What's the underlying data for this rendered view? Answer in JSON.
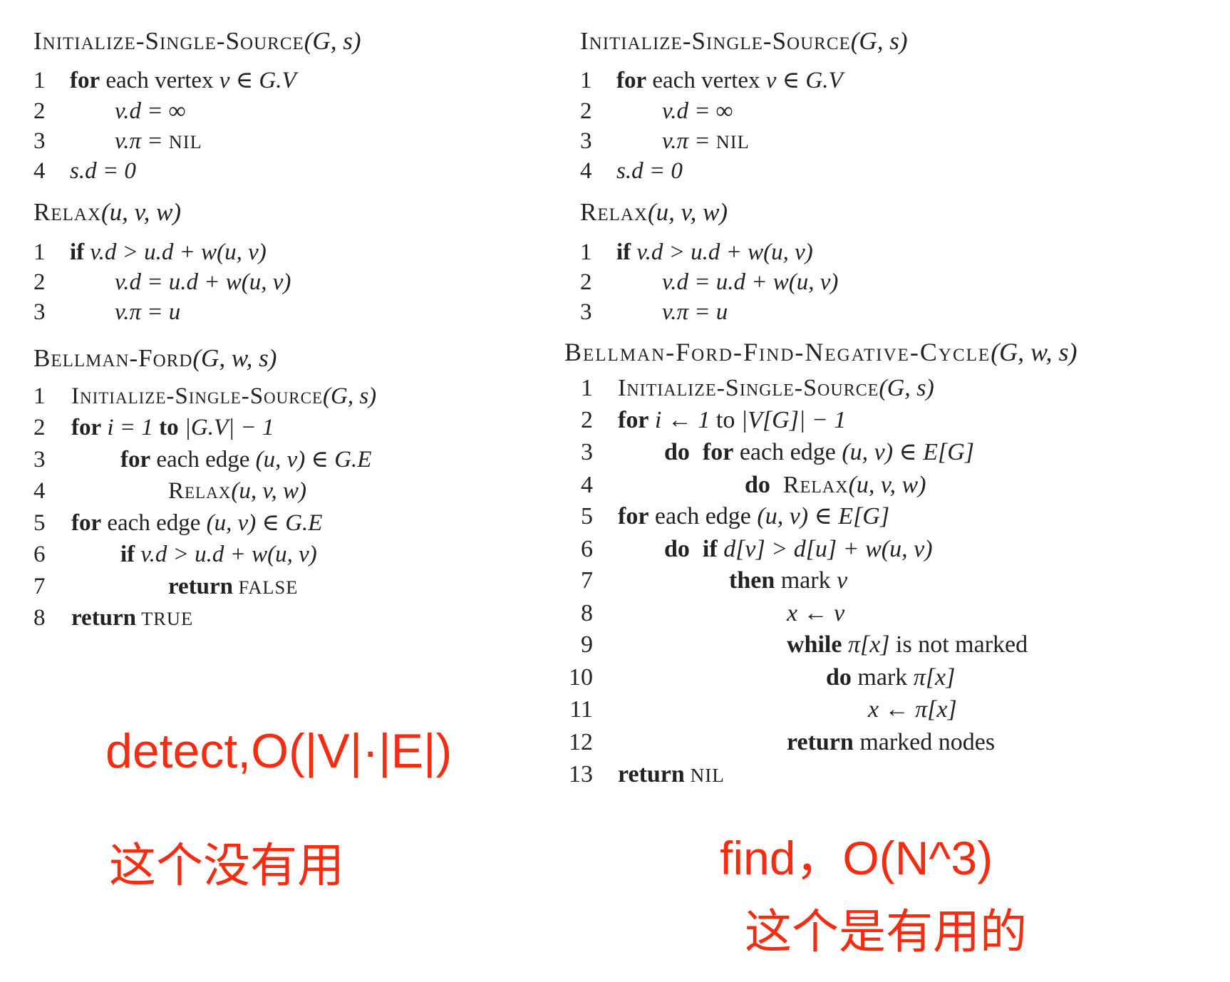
{
  "left": {
    "init": {
      "name": "Initialize-Single-Source",
      "params": "(G, s)",
      "lines": [
        {
          "n": "1",
          "s": [
            "for",
            " each vertex ",
            "v ∈ G.V"
          ]
        },
        {
          "n": "2",
          "s": [
            "v.d = ∞"
          ]
        },
        {
          "n": "3",
          "s": [
            "v.π = ",
            "NIL"
          ]
        },
        {
          "n": "4",
          "s": [
            "s.d = 0"
          ]
        }
      ]
    },
    "relax": {
      "name": "Relax",
      "params": "(u, v, w)",
      "lines": [
        {
          "n": "1",
          "s": [
            "if",
            " v.d > u.d + w(u, v)"
          ]
        },
        {
          "n": "2",
          "s": [
            "v.d = u.d + w(u, v)"
          ]
        },
        {
          "n": "3",
          "s": [
            "v.π = u"
          ]
        }
      ]
    },
    "bellman_ford": {
      "name": "Bellman-Ford",
      "params": "(G, w, s)",
      "lines": [
        {
          "n": "1",
          "s": [
            "Initialize-Single-Source",
            "(G, s)"
          ]
        },
        {
          "n": "2",
          "s": [
            "for",
            " i = 1 ",
            "to",
            " |G.V| − 1"
          ]
        },
        {
          "n": "3",
          "s": [
            "for",
            " each edge ",
            "(u, v) ∈ G.E"
          ]
        },
        {
          "n": "4",
          "s": [
            "Relax",
            "(u, v, w)"
          ]
        },
        {
          "n": "5",
          "s": [
            "for",
            " each edge ",
            "(u, v) ∈ G.E"
          ]
        },
        {
          "n": "6",
          "s": [
            "if",
            " v.d > u.d + w(u, v)"
          ]
        },
        {
          "n": "7",
          "s": [
            "return",
            " FALSE"
          ]
        },
        {
          "n": "8",
          "s": [
            "return",
            " TRUE"
          ]
        }
      ]
    },
    "note_complexity": "detect,O(|V|·|E|)",
    "note_comment": "这个没有用"
  },
  "right": {
    "init": {
      "name": "Initialize-Single-Source",
      "params": "(G, s)",
      "lines": [
        {
          "n": "1",
          "s": [
            "for",
            " each vertex ",
            "v ∈ G.V"
          ]
        },
        {
          "n": "2",
          "s": [
            "v.d = ∞"
          ]
        },
        {
          "n": "3",
          "s": [
            "v.π = ",
            "NIL"
          ]
        },
        {
          "n": "4",
          "s": [
            "s.d = 0"
          ]
        }
      ]
    },
    "relax": {
      "name": "Relax",
      "params": "(u, v, w)",
      "lines": [
        {
          "n": "1",
          "s": [
            "if",
            " v.d > u.d + w(u, v)"
          ]
        },
        {
          "n": "2",
          "s": [
            "v.d = u.d + w(u, v)"
          ]
        },
        {
          "n": "3",
          "s": [
            "v.π = u"
          ]
        }
      ]
    },
    "find_negative_cycle": {
      "name": "Bellman-Ford-Find-Negative-Cycle",
      "params": "(G, w, s)",
      "lines": [
        {
          "n": "1",
          "s": [
            "Initialize-Single-Source",
            "(G, s)"
          ]
        },
        {
          "n": "2",
          "s": [
            "for",
            " i ← 1 ",
            "to",
            " |V[G]| − 1"
          ]
        },
        {
          "n": "3",
          "s": [
            "do",
            "for",
            " each edge ",
            "(u, v) ∈ E[G]"
          ]
        },
        {
          "n": "4",
          "s": [
            "do",
            "Relax",
            "(u, v, w)"
          ]
        },
        {
          "n": "5",
          "s": [
            "for",
            " each edge ",
            "(u, v) ∈ E[G]"
          ]
        },
        {
          "n": "6",
          "s": [
            "do",
            "if",
            " d[v] > d[u] + w(u, v)"
          ]
        },
        {
          "n": "7",
          "s": [
            "then",
            " mark ",
            "v"
          ]
        },
        {
          "n": "8",
          "s": [
            "x ← v"
          ]
        },
        {
          "n": "9",
          "s": [
            "while",
            " π[x]",
            " is not marked"
          ]
        },
        {
          "n": "10",
          "s": [
            "do",
            " mark ",
            "π[x]"
          ]
        },
        {
          "n": "11",
          "s": [
            "x ← π[x]"
          ]
        },
        {
          "n": "12",
          "s": [
            "return",
            " marked nodes"
          ]
        },
        {
          "n": "13",
          "s": [
            "return",
            " NIL"
          ]
        }
      ]
    },
    "note_complexity": "find，O(N^3)",
    "note_comment": "这个是有用的"
  },
  "colors": {
    "text": "#222222",
    "annotation": "#f42c12"
  }
}
